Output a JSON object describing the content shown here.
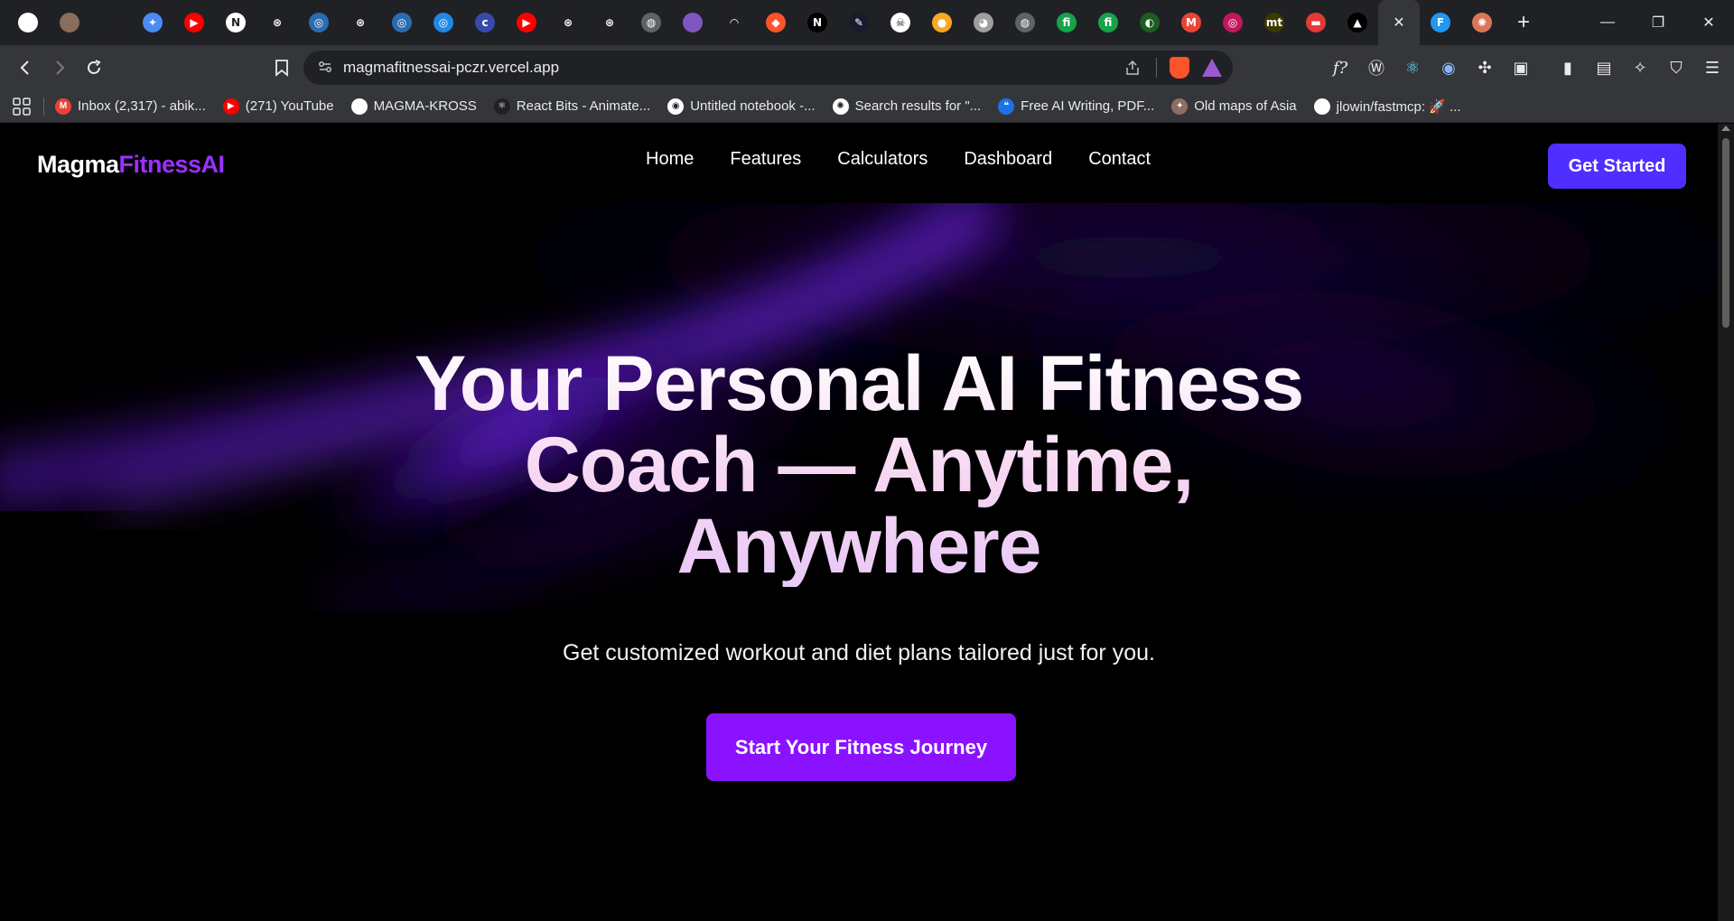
{
  "browser": {
    "tabs": [
      {
        "icon": "github-icon",
        "color": "#ffffff",
        "glyph": ""
      },
      {
        "icon": "avatar-icon",
        "color": "#8a6d5a",
        "glyph": ""
      },
      {
        "icon": "openai-icon",
        "color": "#202124",
        "glyph": ""
      },
      {
        "icon": "gemini-icon",
        "color": "#4c8bf5",
        "glyph": "✦"
      },
      {
        "icon": "youtube-icon",
        "color": "#ff0000",
        "glyph": "▶"
      },
      {
        "icon": "notion-icon",
        "color": "#ffffff",
        "glyph": "N"
      },
      {
        "icon": "chatgpt-icon",
        "color": "#202124",
        "glyph": "⊛"
      },
      {
        "icon": "react-icon",
        "color": "#2b6cb0",
        "glyph": "◎"
      },
      {
        "icon": "chatgpt-icon",
        "color": "#202124",
        "glyph": "⊛"
      },
      {
        "icon": "react-icon",
        "color": "#2b6cb0",
        "glyph": "◎"
      },
      {
        "icon": "react-icon",
        "color": "#1e88e5",
        "glyph": "◎"
      },
      {
        "icon": "copilot-icon",
        "color": "#3949ab",
        "glyph": "c"
      },
      {
        "icon": "youtube-icon",
        "color": "#ff0000",
        "glyph": "▶"
      },
      {
        "icon": "chatgpt-icon",
        "color": "#202124",
        "glyph": "⊛"
      },
      {
        "icon": "chatgpt-icon",
        "color": "#202124",
        "glyph": "⊛"
      },
      {
        "icon": "globe-icon",
        "color": "#5f6368",
        "glyph": "◍"
      },
      {
        "icon": "avatar-icon",
        "color": "#7e57c2",
        "glyph": ""
      },
      {
        "icon": "arc-icon",
        "color": "#202124",
        "glyph": "◠"
      },
      {
        "icon": "brave-icon",
        "color": "#fb542b",
        "glyph": "◆"
      },
      {
        "icon": "next-icon",
        "color": "#000000",
        "glyph": "N"
      },
      {
        "icon": "app-icon",
        "color": "#1a1a2e",
        "glyph": "✎"
      },
      {
        "icon": "skull-icon",
        "color": "#ffffff",
        "glyph": "☠"
      },
      {
        "icon": "coin-icon",
        "color": "#f9a825",
        "glyph": "●"
      },
      {
        "icon": "robot-icon",
        "color": "#9e9e9e",
        "glyph": "◕"
      },
      {
        "icon": "globe-icon",
        "color": "#5f6368",
        "glyph": "◍"
      },
      {
        "icon": "fi-icon",
        "color": "#16a34a",
        "glyph": "fi"
      },
      {
        "icon": "fi-icon",
        "color": "#16a34a",
        "glyph": "fi"
      },
      {
        "icon": "leaf-icon",
        "color": "#1b5e20",
        "glyph": "◐"
      },
      {
        "icon": "gmail-icon",
        "color": "#ea4335",
        "glyph": "M"
      },
      {
        "icon": "spiral-icon",
        "color": "#c2185b",
        "glyph": "◎"
      },
      {
        "icon": "mt-icon",
        "color": "#3a3a00",
        "glyph": "mt"
      },
      {
        "icon": "flag-icon",
        "color": "#e53935",
        "glyph": "▬"
      },
      {
        "icon": "triangle-icon",
        "color": "#000000",
        "glyph": "▲"
      }
    ],
    "active_tab_close": "✕",
    "after_tabs": [
      {
        "icon": "framer-icon",
        "color": "#2196f3",
        "glyph": "F"
      },
      {
        "icon": "claude-icon",
        "color": "#d97757",
        "glyph": "✺"
      }
    ],
    "new_tab": "+",
    "window": {
      "minimize": "—",
      "restore": "❐",
      "close": "✕"
    },
    "url": "magmafitnessai-pczr.vercel.app",
    "bookmarks": [
      {
        "label": "Inbox (2,317) - abik...",
        "icon": "gmail-icon",
        "color": "#ea4335",
        "glyph": "M"
      },
      {
        "label": "(271) YouTube",
        "icon": "youtube-icon",
        "color": "#ff0000",
        "glyph": "▶"
      },
      {
        "label": "MAGMA-KROSS",
        "icon": "github-icon",
        "color": "#ffffff",
        "glyph": ""
      },
      {
        "label": "React Bits - Animate...",
        "icon": "react-bits-icon",
        "color": "#202124",
        "glyph": "⚛"
      },
      {
        "label": "Untitled notebook -...",
        "icon": "notebook-icon",
        "color": "#ffffff",
        "glyph": "◉"
      },
      {
        "label": "Search results for \"...",
        "icon": "search-results-icon",
        "color": "#ffffff",
        "glyph": "✺"
      },
      {
        "label": "Free AI Writing, PDF...",
        "icon": "writing-icon",
        "color": "#1a73e8",
        "glyph": "❝"
      },
      {
        "label": "Old maps of Asia",
        "icon": "map-icon",
        "color": "#8d6e63",
        "glyph": "✦"
      },
      {
        "label": "jlowin/fastmcp: 🚀 ...",
        "icon": "github-icon",
        "color": "#ffffff",
        "glyph": ""
      }
    ]
  },
  "site": {
    "logo": {
      "part1": "Magma",
      "part2": "FitnessAI"
    },
    "nav": [
      "Home",
      "Features",
      "Calculators",
      "Dashboard",
      "Contact"
    ],
    "cta_top": "Get Started",
    "hero": {
      "headline_lines": [
        "Your Personal AI Fitness",
        "Coach — Anytime,",
        "Anywhere"
      ],
      "subtitle": "Get customized workout and diet plans tailored just for you.",
      "cta": "Start Your Fitness Journey"
    },
    "colors": {
      "accent": "#4f2fff",
      "brand": "#9b30ff",
      "cta": "#8a12ff"
    }
  }
}
